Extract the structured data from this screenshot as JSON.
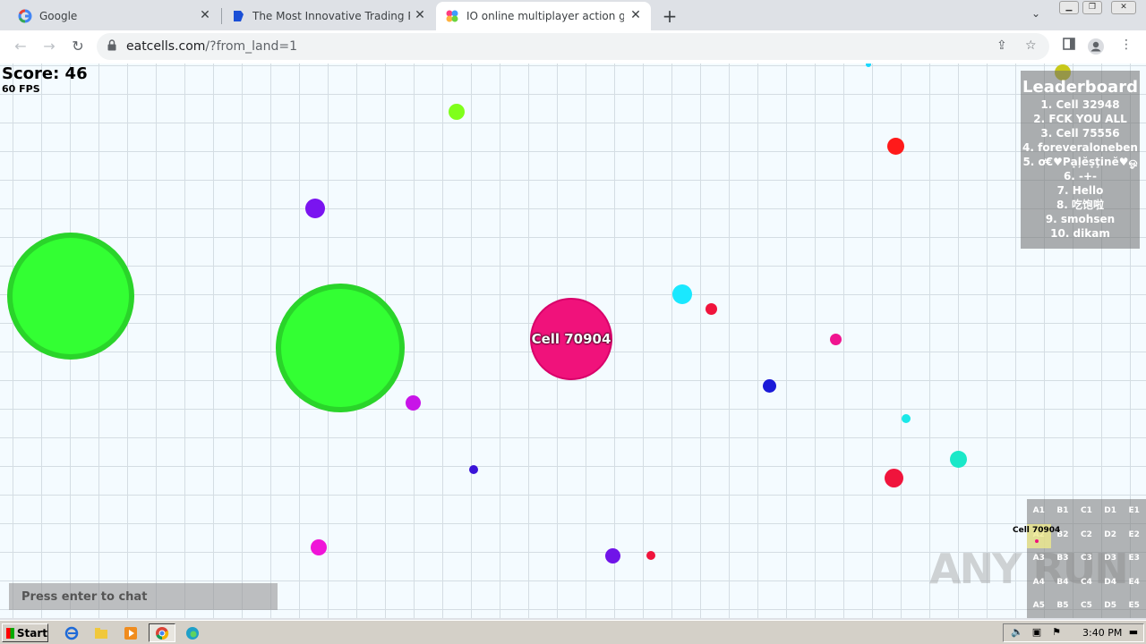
{
  "browser": {
    "tabs": [
      {
        "title": "Google",
        "active": false
      },
      {
        "title": "The Most Innovative Trading Platform",
        "active": false
      },
      {
        "title": "IO online multiplayer action game. St",
        "active": true
      }
    ],
    "url_domain": "eatcells.com",
    "url_path": "/?from_land=1"
  },
  "game": {
    "score_label": "Score: 46",
    "fps_label": "60 FPS",
    "player_name": "Cell 70904",
    "leaderboard_title": "Leaderboard",
    "leaderboard": [
      "1. Cell 32948",
      "2. FCK YOU ALL",
      "3. Cell 75556",
      "4. foreveraloneben",
      "5. ơ€♥Pạļĕṣţinĕ♥ஓ",
      "6. -+-",
      "7. Hello",
      "8. 吃饱啦",
      "9. smohsen",
      "10. dikam"
    ],
    "minimap_grid": [
      [
        "A1",
        "B1",
        "C1",
        "D1",
        "E1"
      ],
      [
        "A2",
        "B2",
        "C2",
        "D2",
        "E2"
      ],
      [
        "A3",
        "B3",
        "C3",
        "D3",
        "E3"
      ],
      [
        "A4",
        "B4",
        "C4",
        "D4",
        "E4"
      ],
      [
        "A5",
        "B5",
        "C5",
        "D5",
        "E5"
      ]
    ],
    "minimap_player_label": "Cell 70904",
    "chat_placeholder": "Press enter to chat",
    "player_color": "#f0127b",
    "virus_color": "#33ff33"
  },
  "watermark": "ANY RUN",
  "taskbar": {
    "start_label": "Start",
    "clock": "3:40 PM"
  }
}
